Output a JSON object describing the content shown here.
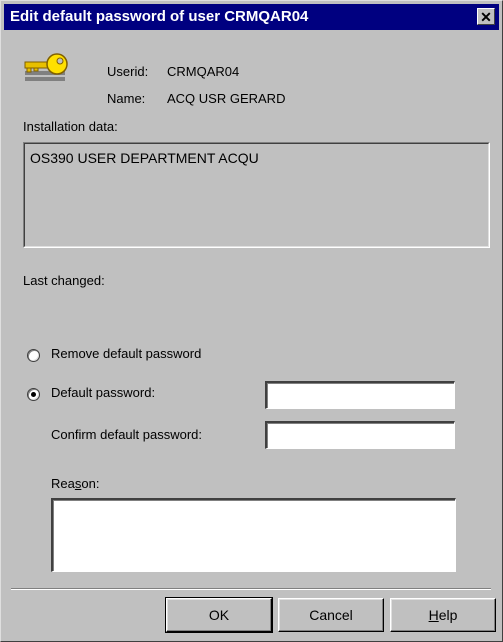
{
  "window": {
    "title": "Edit default password of user CRMQAR04",
    "close_glyph": "✕"
  },
  "user": {
    "icon": "key-icon",
    "userid_label": "Userid:",
    "userid_value": "CRMQAR04",
    "name_label": "Name:",
    "name_value": "ACQ USR GERARD"
  },
  "installation": {
    "label": "Installation data:",
    "value": "OS390 USER DEPARTMENT ACQU"
  },
  "last_changed": {
    "label": "Last changed:",
    "value": ""
  },
  "options": {
    "remove_label": "Remove default password",
    "remove_selected": false,
    "default_label": "Default password:",
    "default_selected": true,
    "confirm_label": "Confirm default password:",
    "default_value": "",
    "confirm_value": ""
  },
  "reason": {
    "label_pre": "Rea",
    "label_accel": "s",
    "label_post": "on:",
    "value": ""
  },
  "buttons": {
    "ok": "OK",
    "cancel": "Cancel",
    "help_accel": "H",
    "help_rest": "elp"
  }
}
